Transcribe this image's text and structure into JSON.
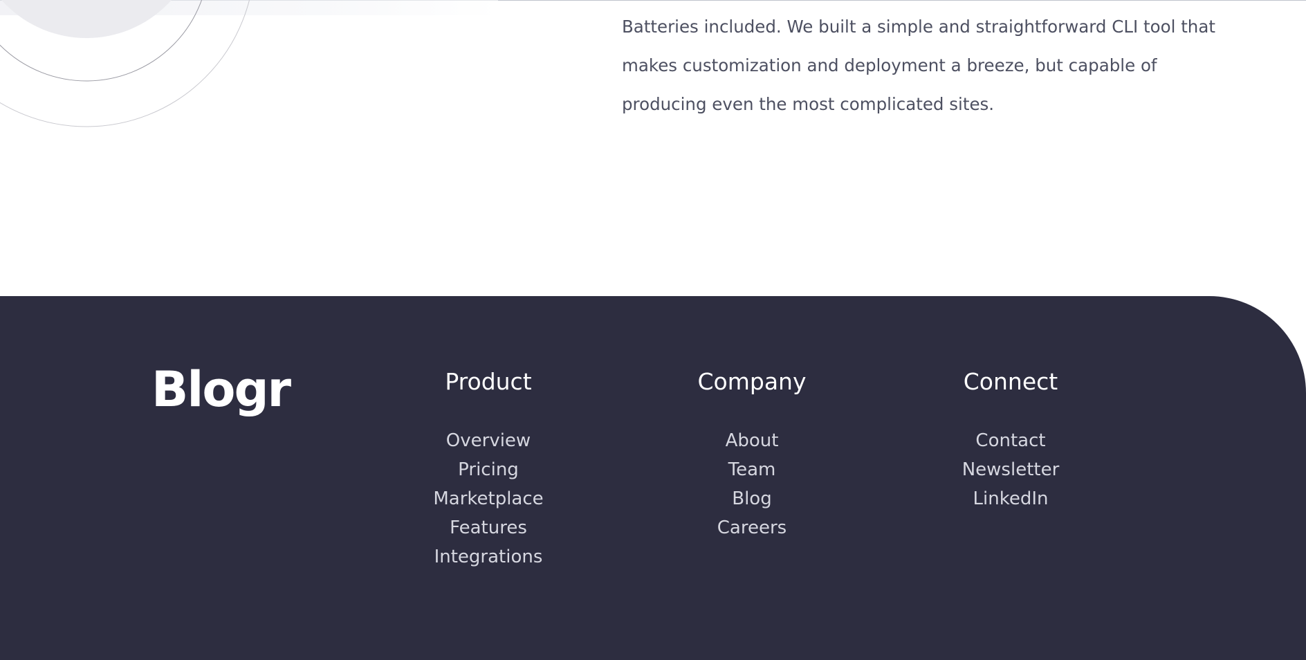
{
  "intro": {
    "text": "Batteries included. We built a simple and straightforward CLI tool that makes customization and deployment a breeze, but capable of producing even the most complicated sites."
  },
  "colors": {
    "footer_bg": "#2d2d40",
    "body_text": "#4d5061",
    "footer_link": "#d6d7e0",
    "white": "#ffffff"
  },
  "footer": {
    "logo": "Blogr",
    "columns": [
      {
        "heading": "Product",
        "links": [
          "Overview",
          "Pricing",
          "Marketplace",
          "Features",
          "Integrations"
        ]
      },
      {
        "heading": "Company",
        "links": [
          "About",
          "Team",
          "Blog",
          "Careers"
        ]
      },
      {
        "heading": "Connect",
        "links": [
          "Contact",
          "Newsletter",
          "LinkedIn"
        ]
      }
    ]
  }
}
